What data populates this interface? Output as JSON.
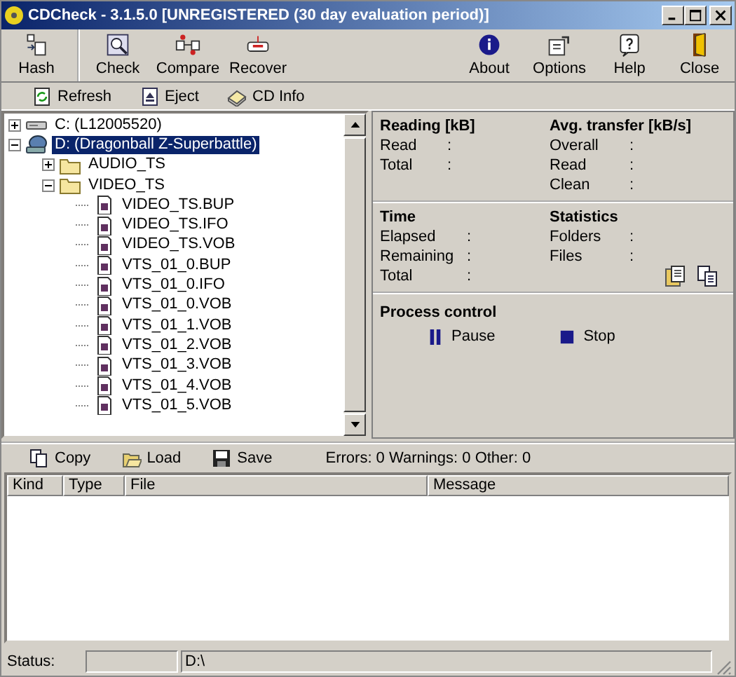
{
  "window": {
    "title": "CDCheck - 3.1.5.0 [UNREGISTERED (30 day evaluation period)]"
  },
  "toolbar": {
    "left": [
      {
        "label": "Hash",
        "kind": "hash"
      }
    ],
    "middle": [
      {
        "label": "Check",
        "kind": "check"
      },
      {
        "label": "Compare",
        "kind": "compare"
      },
      {
        "label": "Recover",
        "kind": "recover"
      }
    ],
    "right": [
      {
        "label": "About",
        "kind": "about"
      },
      {
        "label": "Options",
        "kind": "options"
      },
      {
        "label": "Help",
        "kind": "help"
      },
      {
        "label": "Close",
        "kind": "close"
      }
    ]
  },
  "drive_bar": [
    {
      "label": "Refresh",
      "kind": "refresh"
    },
    {
      "label": "Eject",
      "kind": "eject"
    },
    {
      "label": "CD Info",
      "kind": "info"
    }
  ],
  "tree": [
    {
      "label": "C: (L12005520)",
      "kind": "hdd",
      "expanded": false,
      "selected": false
    },
    {
      "label": "D: (Dragonball Z-Superbattle)",
      "kind": "cd",
      "expanded": true,
      "selected": true,
      "children": [
        {
          "label": "AUDIO_TS",
          "kind": "folder",
          "expanded": false,
          "selected": false
        },
        {
          "label": "VIDEO_TS",
          "kind": "folder",
          "expanded": true,
          "selected": false,
          "children": [
            {
              "label": "VIDEO_TS.BUP",
              "kind": "file",
              "selected": false
            },
            {
              "label": "VIDEO_TS.IFO",
              "kind": "file",
              "selected": false
            },
            {
              "label": "VIDEO_TS.VOB",
              "kind": "file",
              "selected": false
            },
            {
              "label": "VTS_01_0.BUP",
              "kind": "file",
              "selected": false
            },
            {
              "label": "VTS_01_0.IFO",
              "kind": "file",
              "selected": false
            },
            {
              "label": "VTS_01_0.VOB",
              "kind": "file",
              "selected": false
            },
            {
              "label": "VTS_01_1.VOB",
              "kind": "file",
              "selected": false
            },
            {
              "label": "VTS_01_2.VOB",
              "kind": "file",
              "selected": false
            },
            {
              "label": "VTS_01_3.VOB",
              "kind": "file",
              "selected": false
            },
            {
              "label": "VTS_01_4.VOB",
              "kind": "file",
              "selected": false
            },
            {
              "label": "VTS_01_5.VOB",
              "kind": "file",
              "selected": false
            }
          ]
        }
      ]
    }
  ],
  "info_sections": [
    {
      "groups": [
        {
          "title": "Reading [kB]",
          "fields": [
            {
              "label": "Read",
              "colon": ":"
            },
            {
              "label": "Total",
              "colon": ":"
            }
          ]
        },
        {
          "title": "Avg. transfer [kB/s]",
          "fields": [
            {
              "label": "Overall",
              "colon": ":"
            },
            {
              "label": "Read",
              "colon": ":"
            },
            {
              "label": "Clean",
              "colon": ":"
            }
          ]
        }
      ]
    },
    {
      "groups": [
        {
          "title": "Time",
          "fields": [
            {
              "label": "Elapsed",
              "colon": ":"
            },
            {
              "label": "Remaining",
              "colon": ":"
            },
            {
              "label": "Total",
              "colon": ":"
            }
          ]
        },
        {
          "title": "Statistics",
          "fields": [
            {
              "label": "Folders",
              "colon": ":"
            },
            {
              "label": "Files",
              "colon": ":"
            }
          ]
        }
      ]
    }
  ],
  "process_control": {
    "title": "Process control",
    "buttons": [
      {
        "label": "Pause",
        "kind": "pause"
      },
      {
        "label": "Stop",
        "kind": "stop"
      }
    ]
  },
  "log_bar": {
    "buttons": [
      {
        "label": "Copy",
        "kind": "copy"
      },
      {
        "label": "Load",
        "kind": "load"
      },
      {
        "label": "Save",
        "kind": "save"
      }
    ],
    "summary": "Errors: 0 Warnings: 0 Other: 0"
  },
  "log_table": {
    "columns": [
      "Kind",
      "Type",
      "File",
      "Message"
    ]
  },
  "status_bar": {
    "label": "Status:",
    "path": "D:\\"
  }
}
